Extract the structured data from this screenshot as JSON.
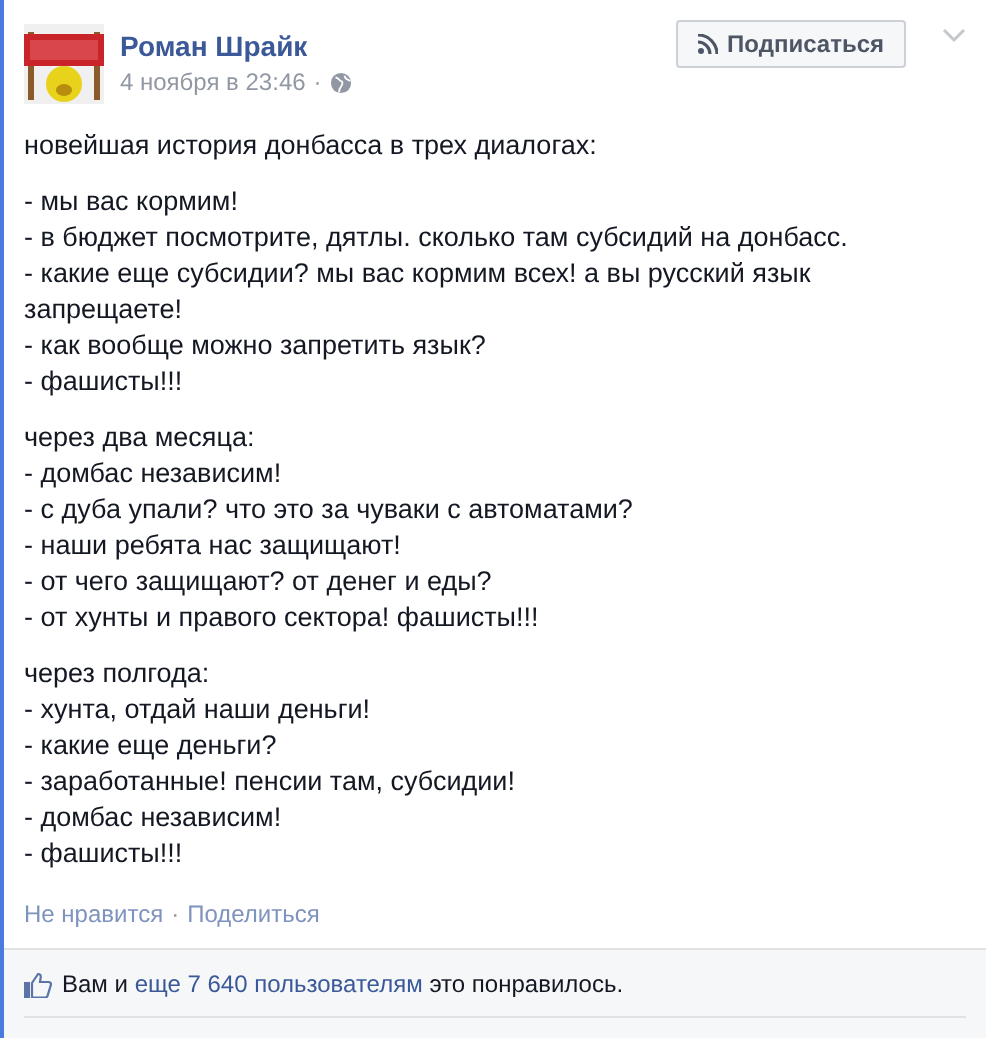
{
  "post": {
    "author": "Роман Шрайк",
    "timestamp": "4 ноября в 23:46",
    "separator": "·",
    "follow_button": "Подписаться",
    "paragraphs": [
      [
        "новейшая история донбасса в трех диалогах:"
      ],
      [
        "- мы вас кормим!",
        "- в бюджет посмотрите, дятлы. сколько там субсидий на донбасс.",
        "- какие еще субсидии? мы вас кормим всех! а вы русский язык запрещаете!",
        "- как вообще можно запретить язык?",
        "- фашисты!!!"
      ],
      [
        "через два месяца:",
        "- домбас независим!",
        "- с дуба упали? что это за чуваки с автоматами?",
        "- наши ребята нас защищают!",
        "- от чего защищают? от денег и еды?",
        "- от хунты и правого сектора! фашисты!!!"
      ],
      [
        "через полгода:",
        "- хунта, отдай наши деньги!",
        "- какие еще деньги?",
        "- заработанные! пенсии там, субсидии!",
        "- домбас независим!",
        "- фашисты!!!"
      ]
    ],
    "actions": [
      "Не нравится",
      "Поделиться"
    ],
    "likes": {
      "prefix": "Вам и",
      "link": "еще 7 640 пользователям",
      "suffix": "это понравилось."
    }
  }
}
